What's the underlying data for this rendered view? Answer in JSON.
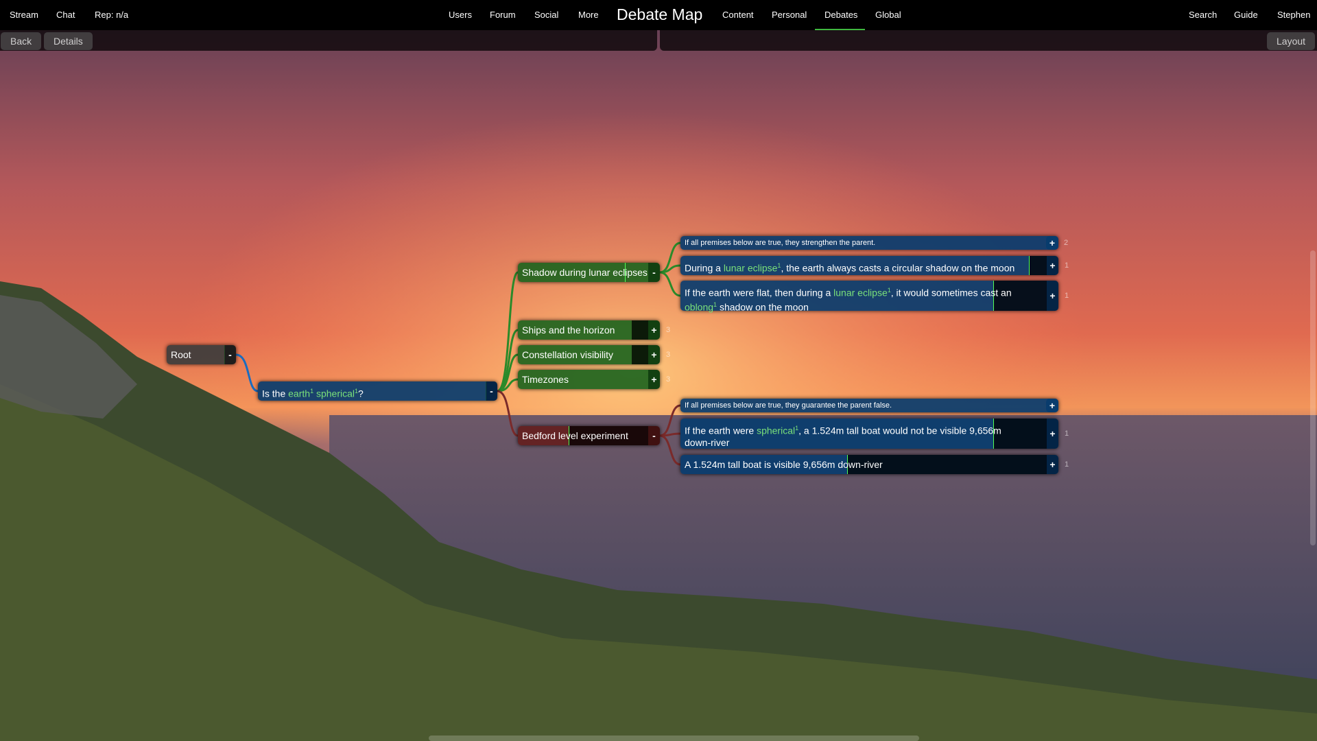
{
  "nav": {
    "left": [
      "Stream",
      "Chat",
      "Rep: n/a"
    ],
    "center_left": [
      "Users",
      "Forum",
      "Social",
      "More"
    ],
    "title": "Debate Map",
    "center_right": [
      "Content",
      "Personal",
      "Debates",
      "Global"
    ],
    "active": "Debates",
    "right": [
      "Search",
      "Guide",
      "Stephen"
    ]
  },
  "toolbar": {
    "back": "Back",
    "details": "Details",
    "layout": "Layout"
  },
  "map": {
    "root": {
      "label": "Root",
      "toggle": "-"
    },
    "question": {
      "pre": "Is the ",
      "term1": "earth",
      "sup1": "1",
      "mid": " ",
      "term2": "spherical",
      "sup2": "1",
      "post": "?",
      "toggle": "-"
    },
    "arguments": [
      {
        "label": "Shadow during lunar eclipses",
        "toggle": "-"
      },
      {
        "label": "Ships and the horizon",
        "toggle": "+",
        "count": "3"
      },
      {
        "label": "Constellation visibility",
        "toggle": "+",
        "count": "3"
      },
      {
        "label": "Timezones",
        "toggle": "+",
        "count": "3"
      },
      {
        "label": "Bedford level experiment",
        "toggle": "-"
      }
    ],
    "pro_premises": {
      "note": "If all premises below are true, they strengthen the parent.",
      "note_toggle": "+",
      "note_count": "2",
      "p1": {
        "pre": "During a ",
        "term": "lunar eclipse",
        "sup": "1",
        "post": ", the earth always casts a circular shadow on the moon",
        "toggle": "+",
        "count": "1"
      },
      "p2": {
        "pre": "If the earth were flat, then during a ",
        "term": "lunar eclipse",
        "sup": "1",
        "mid": ", it would sometimes cast an ",
        "term2": "oblong",
        "sup2": "1",
        "post": " shadow on the moon",
        "toggle": "+",
        "count": "1"
      }
    },
    "con_premises": {
      "note": "If all premises below are true, they guarantee the parent false.",
      "note_toggle": "+",
      "p1": {
        "pre": "If the earth were ",
        "term": "spherical",
        "sup": "1",
        "post": ", a 1.524m tall boat would not be visible 9,656m down-river",
        "toggle": "+",
        "count": "1"
      },
      "p2": {
        "label": "A 1.524m tall boat is visible 9,656m down-river",
        "toggle": "+",
        "count": "1"
      }
    }
  },
  "colors": {
    "accent": "#3fb93f",
    "pro": "#1e641e",
    "con": "#641e1e",
    "question": "#083c6e",
    "highlight": "#7ae07a"
  }
}
